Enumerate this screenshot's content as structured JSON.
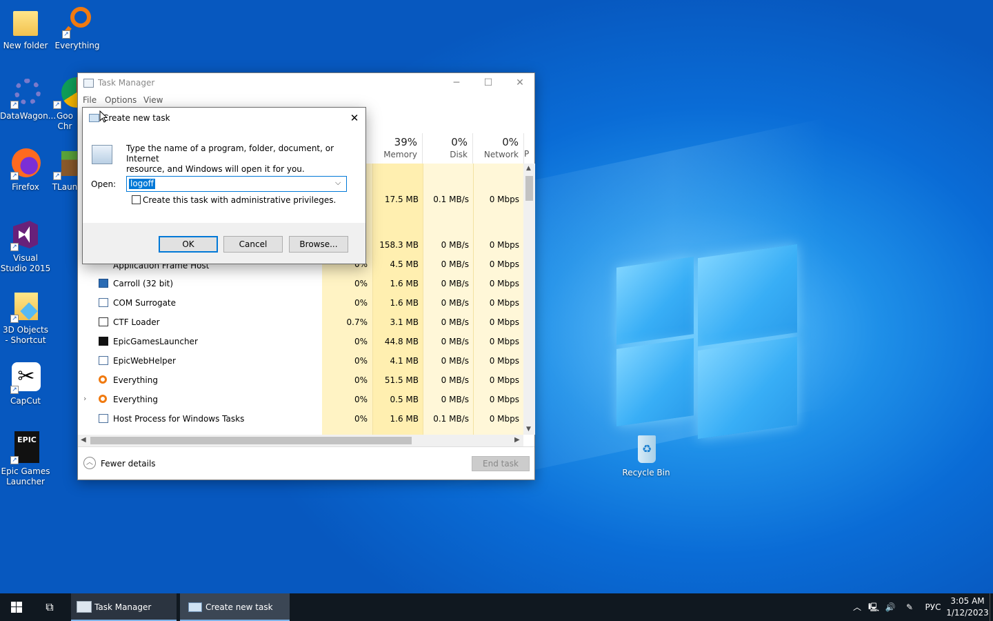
{
  "desktop": {
    "icons": [
      {
        "label": "New folder"
      },
      {
        "label": "Everything"
      },
      {
        "label": "DataWagon..."
      },
      {
        "label": "Goo Chr"
      },
      {
        "label": "Firefox"
      },
      {
        "label": "TLaun"
      },
      {
        "label": "Visual Studio 2015"
      },
      {
        "label": "3D Objects - Shortcut"
      },
      {
        "label": "CapCut"
      },
      {
        "label": "Epic Games Launcher"
      },
      {
        "label": "Recycle Bin"
      }
    ]
  },
  "task_manager": {
    "title": "Task Manager",
    "menu": [
      "File",
      "Options",
      "View"
    ],
    "columns": [
      {
        "pct": "39%",
        "label": "Memory"
      },
      {
        "pct": "0%",
        "label": "Disk"
      },
      {
        "pct": "0%",
        "label": "Network"
      },
      {
        "pct": "",
        "label": "P"
      }
    ],
    "partial_rows": [
      {
        "cpu": "",
        "memory": "17.5 MB",
        "disk": "0.1 MB/s",
        "network": "0 Mbps"
      },
      {
        "cpu": "",
        "memory": "158.3 MB",
        "disk": "0 MB/s",
        "network": "0 Mbps"
      },
      {
        "cpu": "0%",
        "memory": "4.5 MB",
        "disk": "0 MB/s",
        "network": "0 Mbps"
      }
    ],
    "partial_row_name": "Application Frame Host",
    "rows": [
      {
        "name": "Carroll (32 bit)",
        "cpu": "0%",
        "memory": "1.6 MB",
        "disk": "0 MB/s",
        "network": "0 Mbps"
      },
      {
        "name": "COM Surrogate",
        "cpu": "0%",
        "memory": "1.6 MB",
        "disk": "0 MB/s",
        "network": "0 Mbps"
      },
      {
        "name": "CTF Loader",
        "cpu": "0.7%",
        "memory": "3.1 MB",
        "disk": "0 MB/s",
        "network": "0 Mbps"
      },
      {
        "name": "EpicGamesLauncher",
        "cpu": "0%",
        "memory": "44.8 MB",
        "disk": "0 MB/s",
        "network": "0 Mbps"
      },
      {
        "name": "EpicWebHelper",
        "cpu": "0%",
        "memory": "4.1 MB",
        "disk": "0 MB/s",
        "network": "0 Mbps"
      },
      {
        "name": "Everything",
        "cpu": "0%",
        "memory": "51.5 MB",
        "disk": "0 MB/s",
        "network": "0 Mbps"
      },
      {
        "name": "Everything",
        "cpu": "0%",
        "memory": "0.5 MB",
        "disk": "0 MB/s",
        "network": "0 Mbps"
      },
      {
        "name": "Host Process for Windows Tasks",
        "cpu": "0%",
        "memory": "1.6 MB",
        "disk": "0.1 MB/s",
        "network": "0 Mbps"
      }
    ],
    "fewer_details": "Fewer details",
    "end_task": "End task"
  },
  "run_dialog": {
    "title": "Create new task",
    "description_line1": "Type the name of a program, folder, document, or Internet",
    "description_line2": "resource, and Windows will open it for you.",
    "open_label": "Open:",
    "open_value": "logoff",
    "admin_checkbox_label": "Create this task with administrative privileges.",
    "admin_checked": false,
    "ok": "OK",
    "cancel": "Cancel",
    "browse": "Browse..."
  },
  "taskbar": {
    "apps": [
      {
        "label": "Task Manager"
      },
      {
        "label": "Create new task"
      }
    ],
    "language": "РУС",
    "time": "3:05 AM",
    "date": "1/12/2023"
  },
  "colors": {
    "heat_light": "#fff7d4",
    "heat_medium": "#fff0b3",
    "heat_strong": "#ffe9a0",
    "taskbar": "#101820",
    "accent": "#0078d7"
  }
}
